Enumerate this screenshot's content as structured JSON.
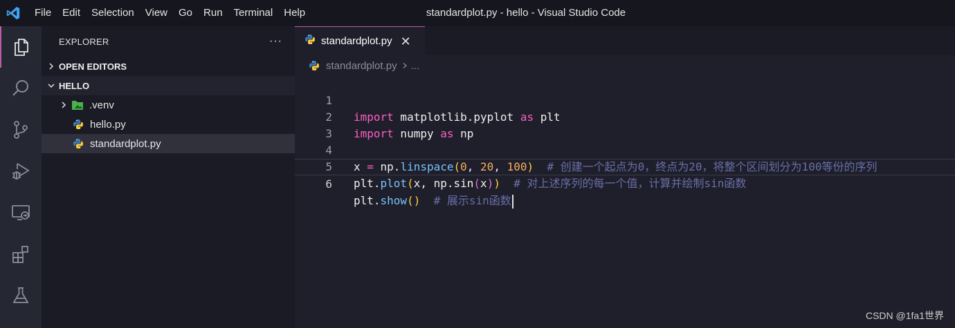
{
  "window": {
    "title": "standardplot.py - hello - Visual Studio Code",
    "menu": [
      "File",
      "Edit",
      "Selection",
      "View",
      "Go",
      "Run",
      "Terminal",
      "Help"
    ]
  },
  "activity_bar": {
    "items": [
      "explorer-icon",
      "search-icon",
      "source-control-icon",
      "run-debug-icon",
      "remote-explorer-icon",
      "extensions-icon",
      "testing-icon"
    ],
    "active": "explorer-icon",
    "accent": "#c15aa7"
  },
  "sidebar": {
    "title": "EXPLORER",
    "more": "···",
    "sections": {
      "open_editors": "OPEN EDITORS",
      "folder": "HELLO"
    },
    "tree": [
      {
        "label": ".venv",
        "icon": "folder-icon",
        "type": "folder"
      },
      {
        "label": "hello.py",
        "icon": "python-icon",
        "type": "file"
      },
      {
        "label": "standardplot.py",
        "icon": "python-icon",
        "type": "file",
        "selected": true
      }
    ]
  },
  "editor": {
    "tab": {
      "label": "standardplot.py",
      "close": "✕"
    },
    "breadcrumb": {
      "file": "standardplot.py",
      "more": "..."
    },
    "lines": [
      {
        "n": "1",
        "current": false
      },
      {
        "n": "2",
        "current": false
      },
      {
        "n": "3",
        "current": false
      },
      {
        "n": "4",
        "current": false
      },
      {
        "n": "5",
        "current": false
      },
      {
        "n": "6",
        "current": true
      }
    ],
    "code": {
      "l1": {
        "kw1": "import",
        "mod": " matplotlib.pyplot ",
        "kw2": "as",
        "alias": " plt"
      },
      "l2": {
        "kw1": "import",
        "mod": " numpy ",
        "kw2": "as",
        "alias": " np"
      },
      "l4": {
        "a": "x ",
        "eq": "=",
        "b": " np.",
        "fn": "linspace",
        "p1": "(",
        "n1": "0",
        "c1": ", ",
        "n2": "20",
        "c2": ", ",
        "n3": "100",
        "p2": ")",
        "cm": "  # 创建一个起点为0，终点为20，将整个区间划分为100等份的序列"
      },
      "l5": {
        "a": "plt.",
        "fn": "plot",
        "p1": "(",
        "b": "x, np.sin",
        "p2": "(",
        "c": "x",
        "p3": ")",
        "p4": ")",
        "cm": "  # 对上述序列的每一个值，计算并绘制sin函数"
      },
      "l6": {
        "a": "plt.",
        "fn": "show",
        "p": "()",
        "cm": "  # 展示sin函数"
      }
    }
  },
  "watermark": "CSDN @1fa1世界"
}
